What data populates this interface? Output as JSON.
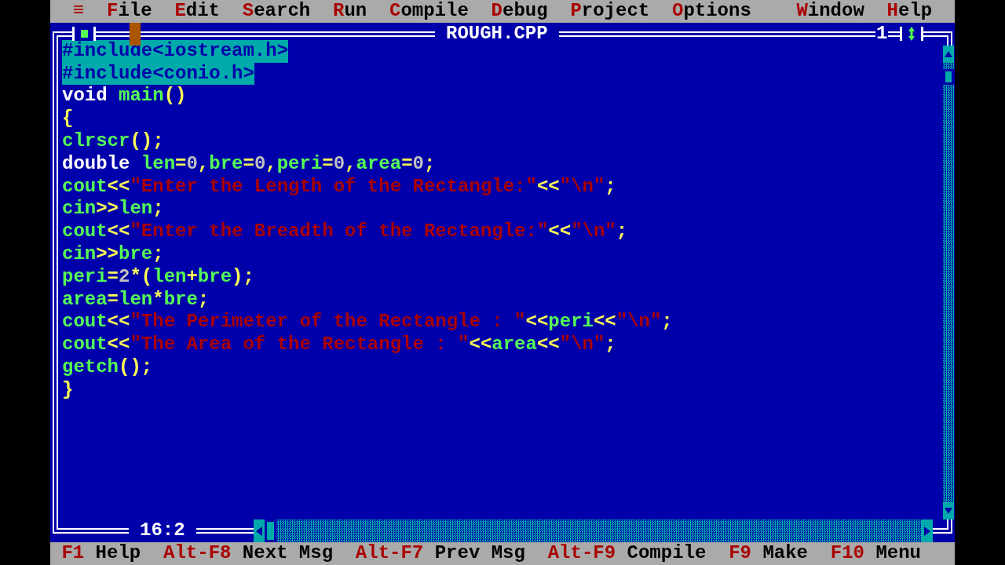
{
  "menu_bar": [
    {
      "key": "≡"
    },
    {
      "key": "F",
      "rest": "ile"
    },
    {
      "key": "E",
      "rest": "dit"
    },
    {
      "key": "S",
      "rest": "earch"
    },
    {
      "key": "R",
      "rest": "un"
    },
    {
      "key": "C",
      "rest": "ompile"
    },
    {
      "key": "D",
      "rest": "ebug"
    },
    {
      "key": "P",
      "rest": "roject"
    },
    {
      "key": "O",
      "rest": "ptions"
    },
    {
      "key": "W",
      "rest": "indow"
    },
    {
      "key": "H",
      "rest": "elp"
    }
  ],
  "editor": {
    "title": "ROUGH.CPP",
    "window_number": "1",
    "cursor_position": "16:2",
    "lines": [
      {
        "selected": true,
        "tokens": [
          {
            "kind": "directive",
            "text": "#include<iostream.h>"
          }
        ]
      },
      {
        "selected": true,
        "tokens": [
          {
            "kind": "directive",
            "text": "#include<conio.h>"
          }
        ]
      },
      {
        "selected": false,
        "tokens": [
          {
            "kind": "keyword",
            "text": "void "
          },
          {
            "kind": "identifier",
            "text": "main"
          },
          {
            "kind": "symbol",
            "text": "()"
          }
        ]
      },
      {
        "selected": false,
        "tokens": [
          {
            "kind": "symbol",
            "text": "{"
          }
        ]
      },
      {
        "selected": false,
        "tokens": [
          {
            "kind": "identifier",
            "text": "clrscr"
          },
          {
            "kind": "symbol",
            "text": "();"
          }
        ]
      },
      {
        "selected": false,
        "tokens": [
          {
            "kind": "keyword",
            "text": "double "
          },
          {
            "kind": "identifier",
            "text": "len"
          },
          {
            "kind": "symbol",
            "text": "="
          },
          {
            "kind": "number",
            "text": "0"
          },
          {
            "kind": "symbol",
            "text": ","
          },
          {
            "kind": "identifier",
            "text": "bre"
          },
          {
            "kind": "symbol",
            "text": "="
          },
          {
            "kind": "number",
            "text": "0"
          },
          {
            "kind": "symbol",
            "text": ","
          },
          {
            "kind": "identifier",
            "text": "peri"
          },
          {
            "kind": "symbol",
            "text": "="
          },
          {
            "kind": "number",
            "text": "0"
          },
          {
            "kind": "symbol",
            "text": ","
          },
          {
            "kind": "identifier",
            "text": "area"
          },
          {
            "kind": "symbol",
            "text": "="
          },
          {
            "kind": "number",
            "text": "0"
          },
          {
            "kind": "symbol",
            "text": ";"
          }
        ]
      },
      {
        "selected": false,
        "tokens": [
          {
            "kind": "identifier",
            "text": "cout"
          },
          {
            "kind": "symbol",
            "text": "<<"
          },
          {
            "kind": "string",
            "text": "\"Enter the Length of the Rectangle:\""
          },
          {
            "kind": "symbol",
            "text": "<<"
          },
          {
            "kind": "string",
            "text": "\"\\n\""
          },
          {
            "kind": "symbol",
            "text": ";"
          }
        ]
      },
      {
        "selected": false,
        "tokens": [
          {
            "kind": "identifier",
            "text": "cin"
          },
          {
            "kind": "symbol",
            "text": ">>"
          },
          {
            "kind": "identifier",
            "text": "len"
          },
          {
            "kind": "symbol",
            "text": ";"
          }
        ]
      },
      {
        "selected": false,
        "tokens": [
          {
            "kind": "identifier",
            "text": "cout"
          },
          {
            "kind": "symbol",
            "text": "<<"
          },
          {
            "kind": "string",
            "text": "\"Enter the Breadth of the Rectangle:\""
          },
          {
            "kind": "symbol",
            "text": "<<"
          },
          {
            "kind": "string",
            "text": "\"\\n\""
          },
          {
            "kind": "symbol",
            "text": ";"
          }
        ]
      },
      {
        "selected": false,
        "tokens": [
          {
            "kind": "identifier",
            "text": "cin"
          },
          {
            "kind": "symbol",
            "text": ">>"
          },
          {
            "kind": "identifier",
            "text": "bre"
          },
          {
            "kind": "symbol",
            "text": ";"
          }
        ]
      },
      {
        "selected": false,
        "tokens": [
          {
            "kind": "identifier",
            "text": "peri"
          },
          {
            "kind": "symbol",
            "text": "="
          },
          {
            "kind": "number",
            "text": "2"
          },
          {
            "kind": "symbol",
            "text": "*("
          },
          {
            "kind": "identifier",
            "text": "len"
          },
          {
            "kind": "symbol",
            "text": "+"
          },
          {
            "kind": "identifier",
            "text": "bre"
          },
          {
            "kind": "symbol",
            "text": ");"
          }
        ]
      },
      {
        "selected": false,
        "tokens": [
          {
            "kind": "identifier",
            "text": "area"
          },
          {
            "kind": "symbol",
            "text": "="
          },
          {
            "kind": "identifier",
            "text": "len"
          },
          {
            "kind": "symbol",
            "text": "*"
          },
          {
            "kind": "identifier",
            "text": "bre"
          },
          {
            "kind": "symbol",
            "text": ";"
          }
        ]
      },
      {
        "selected": false,
        "tokens": [
          {
            "kind": "identifier",
            "text": "cout"
          },
          {
            "kind": "symbol",
            "text": "<<"
          },
          {
            "kind": "string",
            "text": "\"The Perimeter of the Rectangle : \""
          },
          {
            "kind": "symbol",
            "text": "<<"
          },
          {
            "kind": "identifier",
            "text": "peri"
          },
          {
            "kind": "symbol",
            "text": "<<"
          },
          {
            "kind": "string",
            "text": "\"\\n\""
          },
          {
            "kind": "symbol",
            "text": ";"
          }
        ]
      },
      {
        "selected": false,
        "tokens": [
          {
            "kind": "identifier",
            "text": "cout"
          },
          {
            "kind": "symbol",
            "text": "<<"
          },
          {
            "kind": "string",
            "text": "\"The Area of the Rectangle : \""
          },
          {
            "kind": "symbol",
            "text": "<<"
          },
          {
            "kind": "identifier",
            "text": "area"
          },
          {
            "kind": "symbol",
            "text": "<<"
          },
          {
            "kind": "string",
            "text": "\"\\n\""
          },
          {
            "kind": "symbol",
            "text": ";"
          }
        ]
      },
      {
        "selected": false,
        "tokens": [
          {
            "kind": "identifier",
            "text": "getch"
          },
          {
            "kind": "symbol",
            "text": "();"
          }
        ]
      },
      {
        "selected": false,
        "tokens": [
          {
            "kind": "symbol",
            "text": "}"
          }
        ]
      }
    ]
  },
  "status_bar": [
    {
      "key": "F1",
      "label": "Help"
    },
    {
      "key": "Alt-F8",
      "label": "Next Msg"
    },
    {
      "key": "Alt-F7",
      "label": "Prev Msg"
    },
    {
      "key": "Alt-F9",
      "label": "Compile"
    },
    {
      "key": "F9",
      "label": "Make"
    },
    {
      "key": "F10",
      "label": "Menu"
    }
  ]
}
